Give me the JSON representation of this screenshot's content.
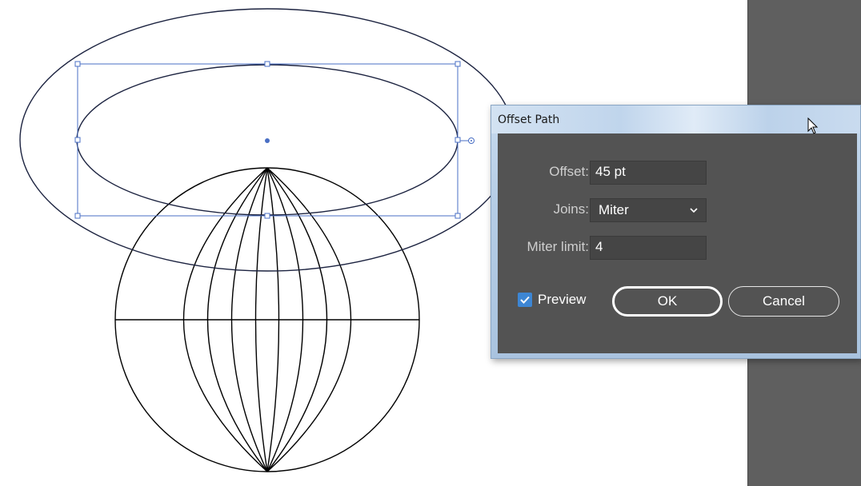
{
  "dialog": {
    "title": "Offset Path",
    "offset": {
      "label": "Offset:",
      "value": "45 pt"
    },
    "joins": {
      "label": "Joins:",
      "value": "Miter"
    },
    "miter_limit": {
      "label": "Miter limit:",
      "value": "4"
    },
    "preview": {
      "label": "Preview",
      "checked": true
    },
    "ok_label": "OK",
    "cancel_label": "Cancel"
  },
  "colors": {
    "selection": "#4a6fc4",
    "panel": "#5f5f5f",
    "dialog_body": "#535353",
    "checkbox": "#3d86d4"
  },
  "icons": {
    "chevron": "chevron-down-icon",
    "check": "checkmark-icon",
    "cursor": "mouse-pointer-icon"
  }
}
